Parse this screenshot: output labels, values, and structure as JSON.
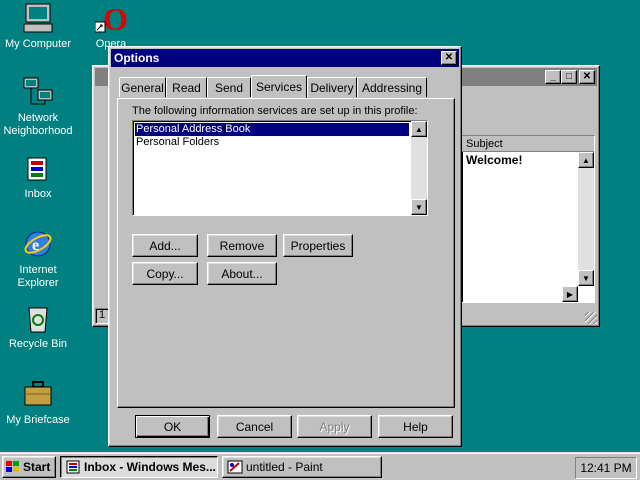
{
  "desktop": {
    "icons": [
      {
        "label": "My Computer"
      },
      {
        "label": "Opera"
      },
      {
        "label": "Network Neighborhood"
      },
      {
        "label": "Inbox"
      },
      {
        "label": "Internet Explorer"
      },
      {
        "label": "Recycle Bin"
      },
      {
        "label": "My Briefcase"
      }
    ]
  },
  "bg_window": {
    "column_subject": "Subject",
    "first_subject": "Welcome!",
    "status": "1"
  },
  "dialog": {
    "title": "Options",
    "close_glyph": "✕",
    "tabs": [
      "General",
      "Read",
      "Send",
      "Services",
      "Delivery",
      "Addressing"
    ],
    "active_tab": "Services",
    "services_label": "The following information services are set up in this profile:",
    "services": [
      "Personal Address Book",
      "Personal Folders"
    ],
    "selected_service": "Personal Address Book",
    "buttons": {
      "add": "Add...",
      "remove": "Remove",
      "properties": "Properties",
      "copy": "Copy...",
      "about": "About..."
    },
    "footer": {
      "ok": "OK",
      "cancel": "Cancel",
      "apply": "Apply",
      "help": "Help"
    }
  },
  "taskbar": {
    "start": "Start",
    "tasks": [
      {
        "label": "Inbox - Windows Mes..."
      },
      {
        "label": "untitled - Paint"
      }
    ],
    "clock": "12:41 PM"
  },
  "colors": {
    "desktop": "#008080",
    "title_active": "#000080",
    "selection": "#000080",
    "face": "#c0c0c0"
  }
}
